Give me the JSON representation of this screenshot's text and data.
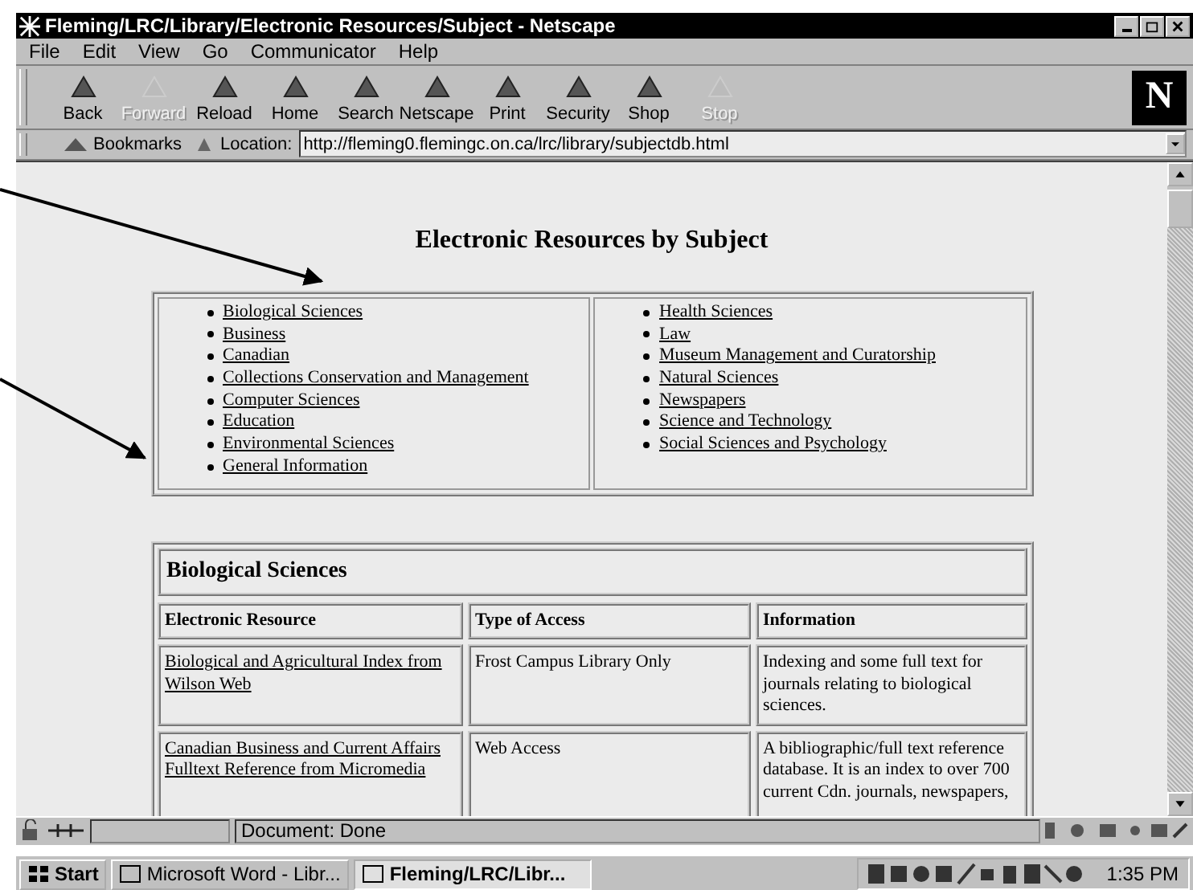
{
  "window": {
    "title": "Fleming/LRC/Library/Electronic Resources/Subject - Netscape"
  },
  "logo": "N",
  "menu": [
    "File",
    "Edit",
    "View",
    "Go",
    "Communicator",
    "Help"
  ],
  "toolbar": [
    {
      "label": "Back",
      "disabled": false
    },
    {
      "label": "Forward",
      "disabled": true
    },
    {
      "label": "Reload",
      "disabled": false
    },
    {
      "label": "Home",
      "disabled": false
    },
    {
      "label": "Search",
      "disabled": false
    },
    {
      "label": "Netscape",
      "disabled": false
    },
    {
      "label": "Print",
      "disabled": false
    },
    {
      "label": "Security",
      "disabled": false
    },
    {
      "label": "Shop",
      "disabled": false
    },
    {
      "label": "Stop",
      "disabled": true
    }
  ],
  "location": {
    "bookmarks": "Bookmarks",
    "label": "Location:",
    "value": "http://fleming0.flemingc.on.ca/lrc/library/subjectdb.html"
  },
  "page": {
    "heading": "Electronic Resources by Subject",
    "subject_columns": [
      [
        "Biological Sciences",
        "Business",
        "Canadian",
        "Collections Conservation and Management",
        "Computer Sciences",
        "Education",
        "Environmental Sciences",
        "General Information"
      ],
      [
        "Health Sciences",
        "Law",
        "Museum Management and Curatorship",
        "Natural Sciences",
        "Newspapers",
        "Science and Technology",
        "Social Sciences and Psychology"
      ]
    ],
    "section": {
      "title": "Biological Sciences",
      "columns": [
        "Electronic Resource",
        "Type of Access",
        "Information"
      ],
      "rows": [
        {
          "resource": "Biological and Agricultural Index from Wilson Web",
          "access": "Frost Campus Library Only",
          "info": "Indexing and some full text for journals relating to biological sciences."
        },
        {
          "resource": "Canadian Business and Current Affairs Fulltext Reference from Micromedia",
          "access": "Web Access",
          "info": "A bibliographic/full text reference database.  It is an index to over 700 current Cdn. journals, newspapers,"
        }
      ]
    }
  },
  "status": "Document: Done",
  "taskbar": {
    "start": "Start",
    "tasks": [
      {
        "label": "Microsoft Word - Libr...",
        "selected": false
      },
      {
        "label": "Fleming/LRC/Libr...",
        "selected": true
      }
    ],
    "clock": "1:35 PM"
  }
}
